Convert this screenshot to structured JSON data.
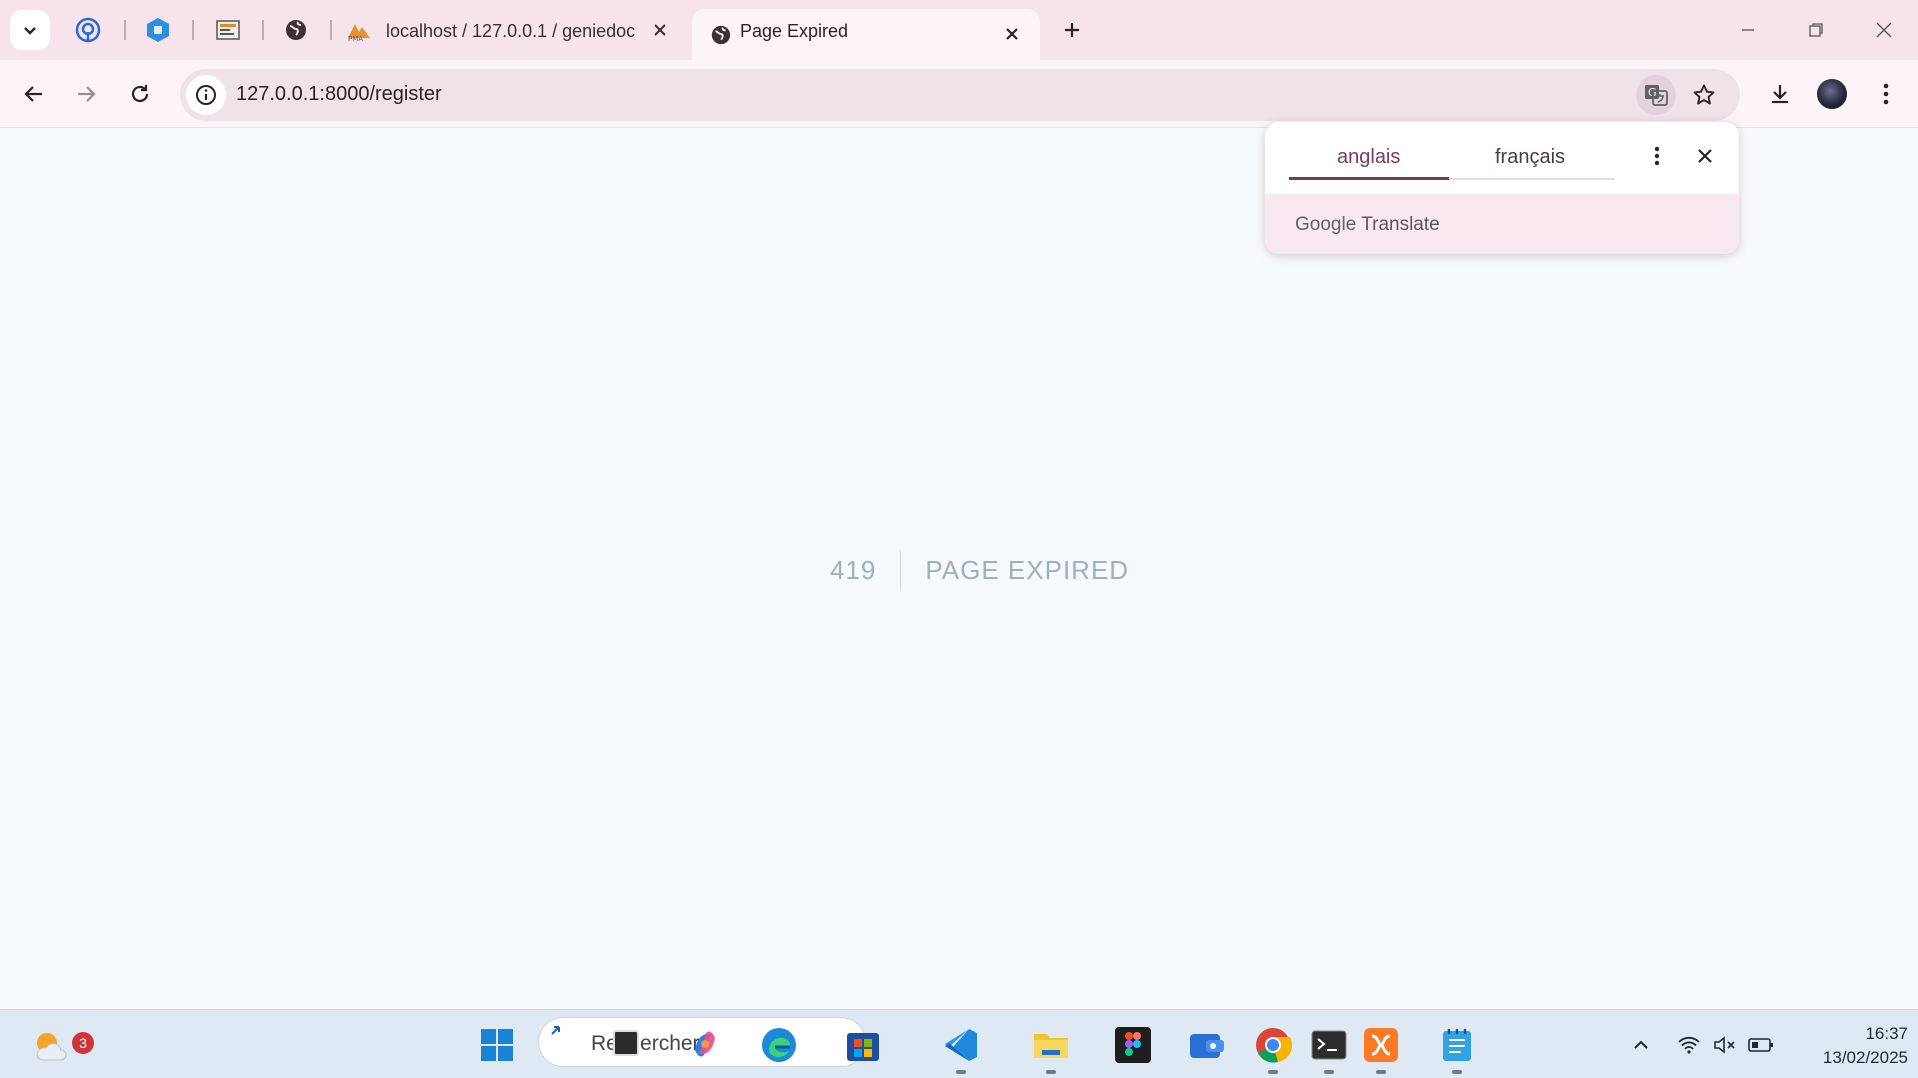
{
  "browser": {
    "tabs": [
      {
        "title": "localhost / 127.0.0.1 / geniedoc",
        "favicon": "phpmyadmin-icon"
      },
      {
        "title": "Page Expired",
        "favicon": "globe-icon",
        "active": true
      }
    ],
    "pinned_tabs": [
      "podcast-icon",
      "hexagon-app-icon",
      "site-thumbnail-icon",
      "globe-icon"
    ],
    "address": "127.0.0.1:8000/register"
  },
  "page": {
    "code": "419",
    "message": "Page Expired",
    "text_color": "#a0aec0"
  },
  "translate_bubble": {
    "source_language": "anglais",
    "target_language": "français",
    "brand": "Google",
    "product": "Translate"
  },
  "taskbar": {
    "weather_badge": "3",
    "search_placeholder": "Rechercher",
    "time": "16:37",
    "date": "13/02/2025"
  }
}
